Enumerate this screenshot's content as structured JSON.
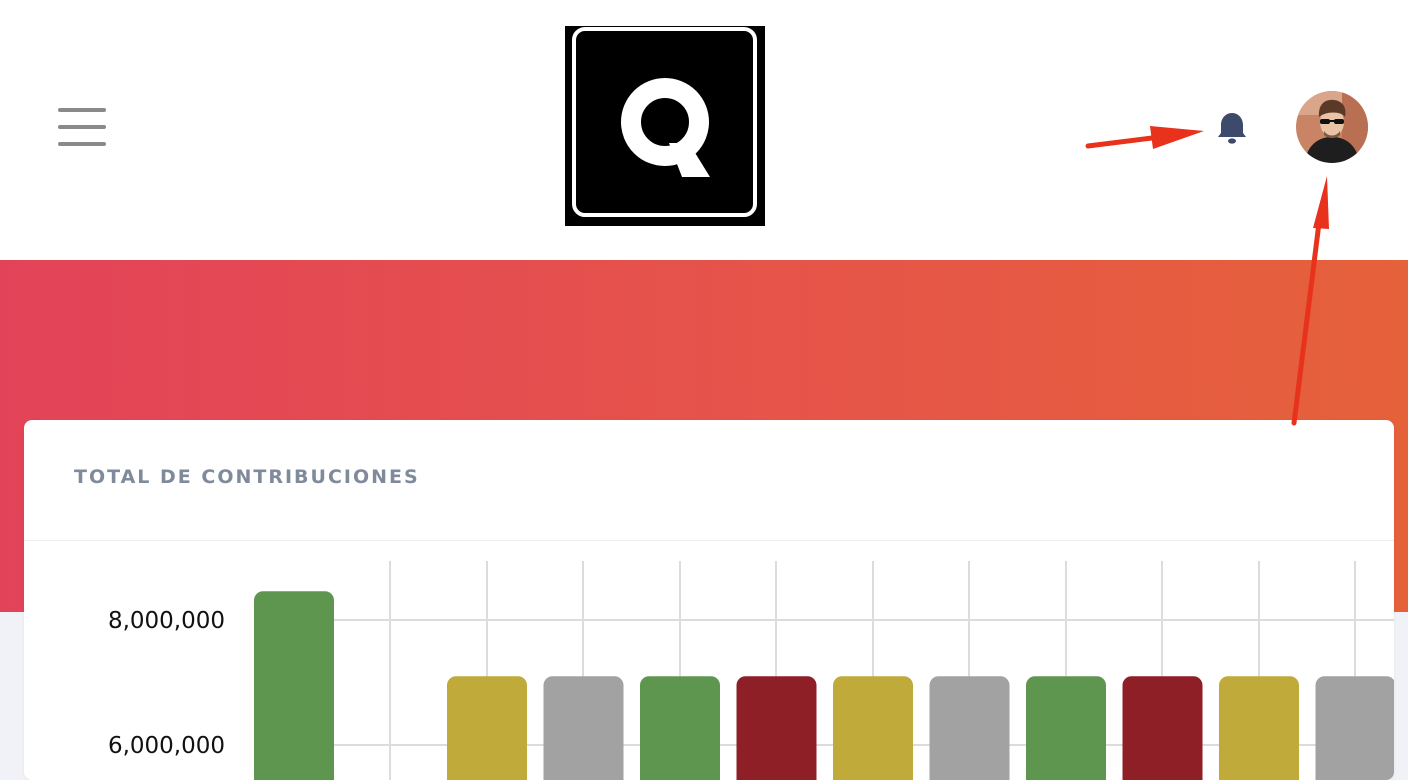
{
  "header": {
    "menu_icon": "hamburger-menu-icon",
    "logo_letter": "Q",
    "notification_icon": "bell-icon",
    "profile_icon": "user-avatar"
  },
  "colors": {
    "hero_start": "#e34358",
    "hero_end": "#e5613a",
    "bell": "#3e4a6b",
    "annotation_arrow": "#e8321c",
    "green": "#5e9650",
    "olive": "#bfaa3a",
    "gray": "#a2a2a2",
    "darkred": "#8e1f26"
  },
  "card": {
    "title": "TOTAL DE CONTRIBUCIONES"
  },
  "chart_data": {
    "type": "bar",
    "title": "TOTAL DE CONTRIBUCIONES",
    "xlabel": "",
    "ylabel": "",
    "categories": [
      "",
      "",
      "",
      "",
      "",
      "",
      "",
      "",
      "",
      "",
      "",
      ""
    ],
    "values": [
      8460000,
      null,
      7100000,
      7100000,
      7100000,
      7100000,
      7100000,
      7100000,
      7100000,
      7100000,
      7100000,
      7100000
    ],
    "bar_colors": [
      "#5e9650",
      null,
      "#bfaa3a",
      "#a2a2a2",
      "#5e9650",
      "#8e1f26",
      "#bfaa3a",
      "#a2a2a2",
      "#5e9650",
      "#8e1f26",
      "#bfaa3a",
      "#a2a2a2"
    ],
    "y_ticks": [
      {
        "value": 8000000,
        "label": "8,000,000"
      },
      {
        "value": 6000000,
        "label": "6,000,000"
      }
    ],
    "ylim_visible": [
      5800000,
      8460000
    ],
    "grid": true
  }
}
